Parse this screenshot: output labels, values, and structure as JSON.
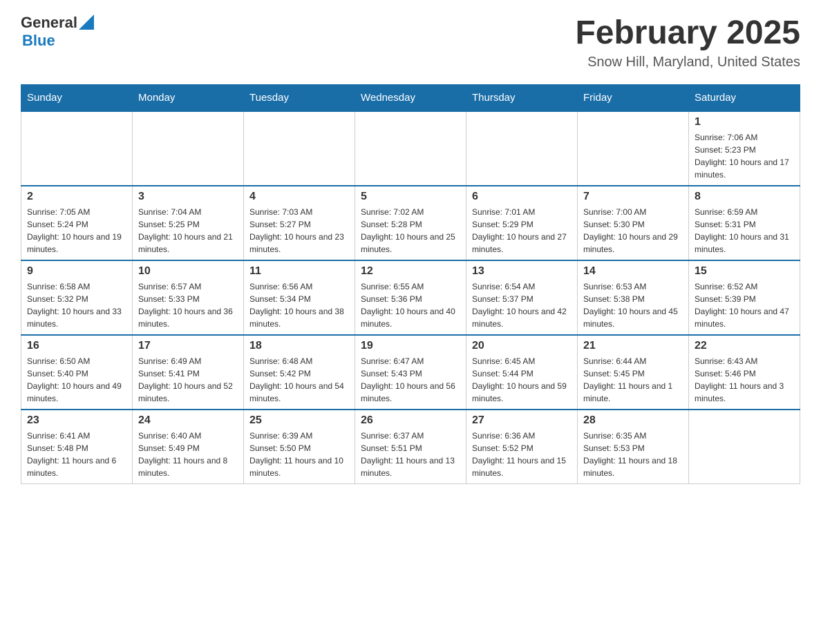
{
  "header": {
    "logo": {
      "general": "General",
      "blue": "Blue",
      "icon": "▶"
    },
    "title": "February 2025",
    "subtitle": "Snow Hill, Maryland, United States"
  },
  "days_of_week": [
    "Sunday",
    "Monday",
    "Tuesday",
    "Wednesday",
    "Thursday",
    "Friday",
    "Saturday"
  ],
  "weeks": [
    [
      {
        "day": "",
        "info": ""
      },
      {
        "day": "",
        "info": ""
      },
      {
        "day": "",
        "info": ""
      },
      {
        "day": "",
        "info": ""
      },
      {
        "day": "",
        "info": ""
      },
      {
        "day": "",
        "info": ""
      },
      {
        "day": "1",
        "info": "Sunrise: 7:06 AM\nSunset: 5:23 PM\nDaylight: 10 hours and 17 minutes."
      }
    ],
    [
      {
        "day": "2",
        "info": "Sunrise: 7:05 AM\nSunset: 5:24 PM\nDaylight: 10 hours and 19 minutes."
      },
      {
        "day": "3",
        "info": "Sunrise: 7:04 AM\nSunset: 5:25 PM\nDaylight: 10 hours and 21 minutes."
      },
      {
        "day": "4",
        "info": "Sunrise: 7:03 AM\nSunset: 5:27 PM\nDaylight: 10 hours and 23 minutes."
      },
      {
        "day": "5",
        "info": "Sunrise: 7:02 AM\nSunset: 5:28 PM\nDaylight: 10 hours and 25 minutes."
      },
      {
        "day": "6",
        "info": "Sunrise: 7:01 AM\nSunset: 5:29 PM\nDaylight: 10 hours and 27 minutes."
      },
      {
        "day": "7",
        "info": "Sunrise: 7:00 AM\nSunset: 5:30 PM\nDaylight: 10 hours and 29 minutes."
      },
      {
        "day": "8",
        "info": "Sunrise: 6:59 AM\nSunset: 5:31 PM\nDaylight: 10 hours and 31 minutes."
      }
    ],
    [
      {
        "day": "9",
        "info": "Sunrise: 6:58 AM\nSunset: 5:32 PM\nDaylight: 10 hours and 33 minutes."
      },
      {
        "day": "10",
        "info": "Sunrise: 6:57 AM\nSunset: 5:33 PM\nDaylight: 10 hours and 36 minutes."
      },
      {
        "day": "11",
        "info": "Sunrise: 6:56 AM\nSunset: 5:34 PM\nDaylight: 10 hours and 38 minutes."
      },
      {
        "day": "12",
        "info": "Sunrise: 6:55 AM\nSunset: 5:36 PM\nDaylight: 10 hours and 40 minutes."
      },
      {
        "day": "13",
        "info": "Sunrise: 6:54 AM\nSunset: 5:37 PM\nDaylight: 10 hours and 42 minutes."
      },
      {
        "day": "14",
        "info": "Sunrise: 6:53 AM\nSunset: 5:38 PM\nDaylight: 10 hours and 45 minutes."
      },
      {
        "day": "15",
        "info": "Sunrise: 6:52 AM\nSunset: 5:39 PM\nDaylight: 10 hours and 47 minutes."
      }
    ],
    [
      {
        "day": "16",
        "info": "Sunrise: 6:50 AM\nSunset: 5:40 PM\nDaylight: 10 hours and 49 minutes."
      },
      {
        "day": "17",
        "info": "Sunrise: 6:49 AM\nSunset: 5:41 PM\nDaylight: 10 hours and 52 minutes."
      },
      {
        "day": "18",
        "info": "Sunrise: 6:48 AM\nSunset: 5:42 PM\nDaylight: 10 hours and 54 minutes."
      },
      {
        "day": "19",
        "info": "Sunrise: 6:47 AM\nSunset: 5:43 PM\nDaylight: 10 hours and 56 minutes."
      },
      {
        "day": "20",
        "info": "Sunrise: 6:45 AM\nSunset: 5:44 PM\nDaylight: 10 hours and 59 minutes."
      },
      {
        "day": "21",
        "info": "Sunrise: 6:44 AM\nSunset: 5:45 PM\nDaylight: 11 hours and 1 minute."
      },
      {
        "day": "22",
        "info": "Sunrise: 6:43 AM\nSunset: 5:46 PM\nDaylight: 11 hours and 3 minutes."
      }
    ],
    [
      {
        "day": "23",
        "info": "Sunrise: 6:41 AM\nSunset: 5:48 PM\nDaylight: 11 hours and 6 minutes."
      },
      {
        "day": "24",
        "info": "Sunrise: 6:40 AM\nSunset: 5:49 PM\nDaylight: 11 hours and 8 minutes."
      },
      {
        "day": "25",
        "info": "Sunrise: 6:39 AM\nSunset: 5:50 PM\nDaylight: 11 hours and 10 minutes."
      },
      {
        "day": "26",
        "info": "Sunrise: 6:37 AM\nSunset: 5:51 PM\nDaylight: 11 hours and 13 minutes."
      },
      {
        "day": "27",
        "info": "Sunrise: 6:36 AM\nSunset: 5:52 PM\nDaylight: 11 hours and 15 minutes."
      },
      {
        "day": "28",
        "info": "Sunrise: 6:35 AM\nSunset: 5:53 PM\nDaylight: 11 hours and 18 minutes."
      },
      {
        "day": "",
        "info": ""
      }
    ]
  ]
}
